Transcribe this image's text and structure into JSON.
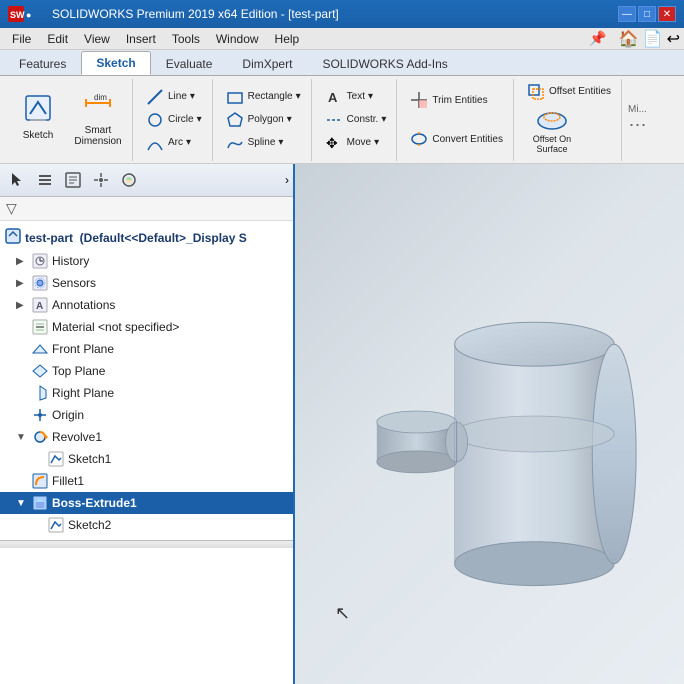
{
  "app": {
    "title": "SOLIDWORKS",
    "document": "test-part"
  },
  "titlebar": {
    "title": "SOLIDWORKS Premium 2019 x64 Edition - [test-part]",
    "controls": [
      "—",
      "□",
      "✕"
    ]
  },
  "menubar": {
    "items": [
      "File",
      "Edit",
      "View",
      "Insert",
      "Tools",
      "Window",
      "Help"
    ]
  },
  "ribbon": {
    "tabs": [
      "Features",
      "Sketch",
      "Evaluate",
      "DimXpert",
      "SOLIDWORKS Add-Ins"
    ],
    "active_tab": "Sketch",
    "groups": [
      {
        "name": "sketch-group",
        "buttons": [
          {
            "label": "Sketch",
            "icon": "pencil"
          },
          {
            "label": "Smart Dimension",
            "icon": "dimension"
          }
        ]
      }
    ],
    "tools": {
      "trim_entities": "Trim Entities",
      "convert_entities": "Convert Entities",
      "offset_entities": "Offset Entities",
      "offset_on_surface": "Offset On Surface"
    }
  },
  "panel": {
    "toolbar_buttons": [
      "cursor",
      "list",
      "list-detail",
      "crosshair",
      "pie"
    ],
    "filter_placeholder": "",
    "tree": {
      "root": "test-part  (Default<<Default>_Display S",
      "items": [
        {
          "id": "history",
          "label": "History",
          "indent": 1,
          "icon": "clock",
          "expanded": false
        },
        {
          "id": "sensors",
          "label": "Sensors",
          "indent": 1,
          "icon": "sensor"
        },
        {
          "id": "annotations",
          "label": "Annotations",
          "indent": 1,
          "icon": "annotation"
        },
        {
          "id": "material",
          "label": "Material <not specified>",
          "indent": 1,
          "icon": "material"
        },
        {
          "id": "front-plane",
          "label": "Front Plane",
          "indent": 1,
          "icon": "plane"
        },
        {
          "id": "top-plane",
          "label": "Top Plane",
          "indent": 1,
          "icon": "plane"
        },
        {
          "id": "right-plane",
          "label": "Right Plane",
          "indent": 1,
          "icon": "plane"
        },
        {
          "id": "origin",
          "label": "Origin",
          "indent": 1,
          "icon": "origin"
        },
        {
          "id": "revolve1",
          "label": "Revolve1",
          "indent": 1,
          "icon": "revolve",
          "expanded": true
        },
        {
          "id": "sketch1",
          "label": "Sketch1",
          "indent": 2,
          "icon": "sketch"
        },
        {
          "id": "fillet1",
          "label": "Fillet1",
          "indent": 1,
          "icon": "fillet"
        },
        {
          "id": "boss-extrude1",
          "label": "Boss-Extrude1",
          "indent": 1,
          "icon": "extrude",
          "expanded": true,
          "selected": true
        },
        {
          "id": "sketch2",
          "label": "Sketch2",
          "indent": 2,
          "icon": "sketch"
        }
      ]
    }
  },
  "viewport": {
    "background_start": "#c8d0d8",
    "background_end": "#e8edf2"
  }
}
